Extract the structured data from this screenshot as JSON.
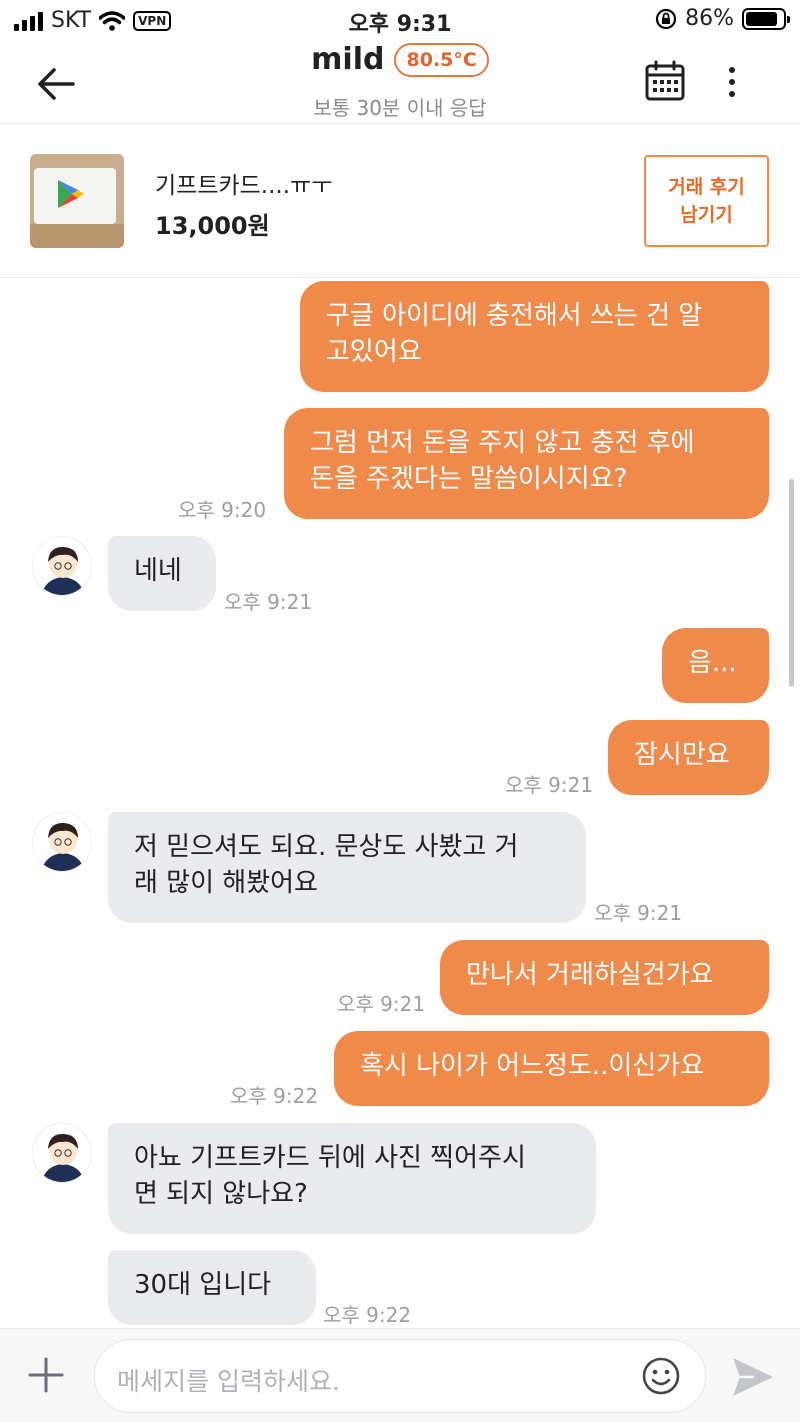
{
  "status_bar": {
    "carrier": "SKT",
    "vpn": "VPN",
    "time": "오후 9:31",
    "battery": "86%",
    "battery_level": 0.86
  },
  "header": {
    "name": "mild",
    "temperature": "80.5°C",
    "response": "보통 30분 이내 응답"
  },
  "product": {
    "title": "기프트카드....ㅠㅜ",
    "price": "13,000원",
    "review_button": "거래 후기\n남기기"
  },
  "messages": [
    {
      "sender": "me",
      "text": "구글 아이디에 충전해서 쓰는 건 알\n고있어요",
      "time": ""
    },
    {
      "sender": "me",
      "text": "그럼 먼저 돈을 주지 않고 충전 후에\n돈을 주겠다는 말씀이시지요?",
      "time": "오후 9:20"
    },
    {
      "sender": "other",
      "text": "네네",
      "time": "오후 9:21"
    },
    {
      "sender": "me",
      "text": "음...",
      "time": ""
    },
    {
      "sender": "me",
      "text": "잠시만요",
      "time": "오후 9:21"
    },
    {
      "sender": "other",
      "text": "저 믿으셔도 되요. 문상도 사봤고 거\n래 많이 해봤어요",
      "time": "오후 9:21"
    },
    {
      "sender": "me",
      "text": "만나서 거래하실건가요",
      "time": "오후 9:21"
    },
    {
      "sender": "me",
      "text": "혹시 나이가 어느정도..이신가요",
      "time": "오후 9:22"
    },
    {
      "sender": "other",
      "text": "아뇨 기프트카드 뒤에 사진 찍어주시\n면 되지 않나요?",
      "time": ""
    },
    {
      "sender": "other",
      "text": "30대 입니다",
      "time": "오후 9:22"
    }
  ],
  "input": {
    "placeholder": "메세지를 입력하세요."
  },
  "icons": {
    "back": "arrow-left-icon",
    "calendar": "calendar-icon",
    "more": "more-vertical-icon",
    "plus": "plus-icon",
    "emoji": "emoji-icon",
    "send": "send-icon"
  },
  "colors": {
    "accent": "#f08a4b",
    "temperature": "#dd6633",
    "other_bubble": "#e9ebee",
    "time_text": "#9a9ea5"
  }
}
